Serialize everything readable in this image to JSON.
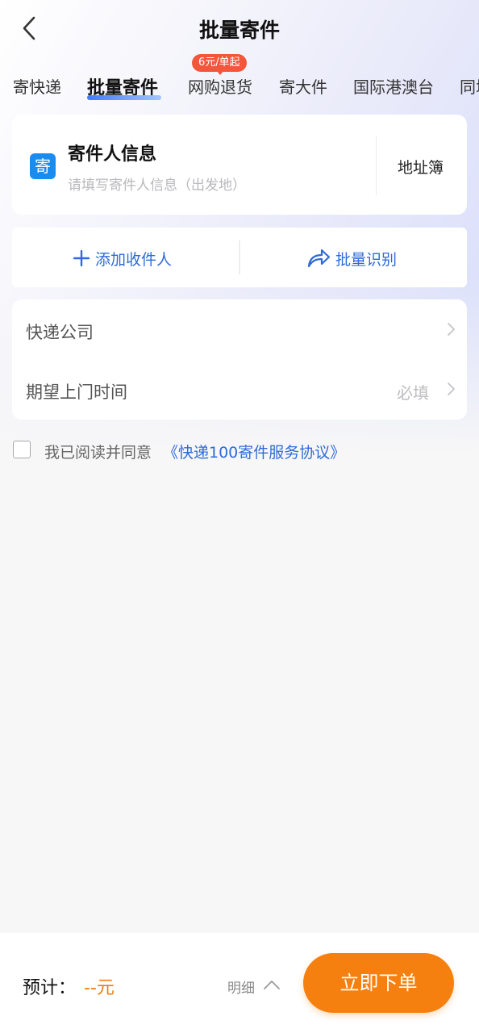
{
  "header": {
    "title": "批量寄件"
  },
  "tabs": [
    {
      "label": "寄快递"
    },
    {
      "label": "批量寄件",
      "active": true
    },
    {
      "label": "网购退货",
      "badge": "6元/单起"
    },
    {
      "label": "寄大件"
    },
    {
      "label": "国际港澳台"
    },
    {
      "label": "同城"
    }
  ],
  "sender": {
    "badge": "寄",
    "title": "寄件人信息",
    "placeholder": "请填写寄件人信息（出发地）",
    "address_book": "地址簿"
  },
  "actions": {
    "add_recipient": "添加收件人",
    "batch_recognize": "批量识别"
  },
  "form": {
    "courier_label": "快递公司",
    "pickup_label": "期望上门时间",
    "pickup_value": "必填"
  },
  "agreement": {
    "prefix": "我已阅读并同意",
    "link": "《快递100寄件服务协议》",
    "checked": false
  },
  "footer": {
    "estimate_label": "预计：",
    "estimate_value": "--元",
    "detail_label": "明细",
    "order_button": "立即下单"
  },
  "colors": {
    "accent_blue": "#2f6bd8",
    "badge_blue": "#1a8cf0",
    "order_orange": "#f5800f",
    "price_orange": "#f27b13",
    "promo_red": "#f4563b"
  }
}
